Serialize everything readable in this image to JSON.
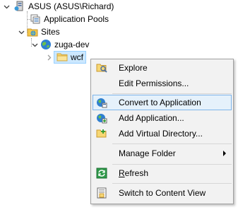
{
  "tree": {
    "server": "ASUS (ASUS\\Richard)",
    "app_pools": "Application Pools",
    "sites": "Sites",
    "site": "zuga-dev",
    "folder": "wcf"
  },
  "context_menu": {
    "items": [
      {
        "label": "Explore",
        "icon": "explore-icon"
      },
      {
        "label": "Edit Permissions...",
        "icon": ""
      },
      {
        "label": "Convert to Application",
        "icon": "convert-icon"
      },
      {
        "label": "Add Application...",
        "icon": "add-application-icon"
      },
      {
        "label": "Add Virtual Directory...",
        "icon": "add-virtual-directory-icon"
      },
      {
        "label": "Manage Folder",
        "icon": ""
      },
      {
        "label_underlined": "R",
        "label_rest": "efresh",
        "icon": "refresh-icon"
      },
      {
        "label": "Switch to Content View",
        "icon": "content-view-icon"
      }
    ]
  },
  "colors": {
    "selection_bg": "#cce8ff",
    "menu_highlight": "#e5f1fb",
    "menu_highlight_border": "#7eb4ea",
    "menu_bg": "#f2f2f2"
  }
}
